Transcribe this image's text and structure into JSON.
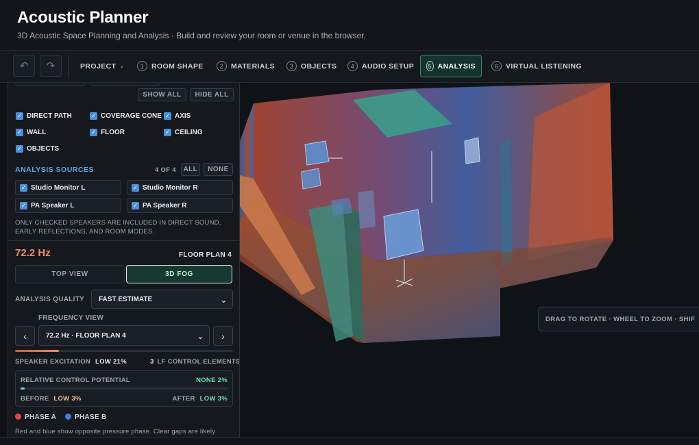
{
  "header": {
    "title": "Acoustic Planner",
    "subtitle": "3D Acoustic Space Planning and Analysis · Build and review your room or venue in the browser."
  },
  "toolbar": {
    "undo_icon": "undo-icon",
    "redo_icon": "redo-icon",
    "project_label": "PROJECT",
    "tabs": [
      {
        "num": "1",
        "label": "ROOM SHAPE"
      },
      {
        "num": "2",
        "label": "MATERIALS"
      },
      {
        "num": "3",
        "label": "OBJECTS"
      },
      {
        "num": "4",
        "label": "AUDIO SETUP"
      },
      {
        "num": "5",
        "label": "ANALYSIS",
        "active": true
      },
      {
        "num": "6",
        "label": "VIRTUAL LISTENING"
      }
    ]
  },
  "panel": {
    "show_all": "SHOW ALL",
    "hide_all": "HIDE ALL",
    "toggles": [
      {
        "label": "DIRECT PATH",
        "checked": true
      },
      {
        "label": "COVERAGE CONE",
        "checked": true
      },
      {
        "label": "AXIS",
        "checked": true
      },
      {
        "label": "WALL",
        "checked": true
      },
      {
        "label": "FLOOR",
        "checked": true
      },
      {
        "label": "CEILING",
        "checked": true
      },
      {
        "label": "OBJECTS",
        "checked": true
      }
    ],
    "sources": {
      "title": "ANALYSIS SOURCES",
      "count": "4 OF 4",
      "all": "ALL",
      "none": "NONE",
      "items": [
        {
          "label": "Studio Monitor L",
          "checked": true
        },
        {
          "label": "Studio Monitor R",
          "checked": true
        },
        {
          "label": "PA Speaker L",
          "checked": true
        },
        {
          "label": "PA Speaker R",
          "checked": true
        }
      ],
      "note_line1": "ONLY CHECKED SPEAKERS ARE INCLUDED IN DIRECT SOUND,",
      "note_line2": "EARLY REFLECTIONS, AND ROOM MODES."
    },
    "frequency": "72.2 Hz",
    "floor_plan": "FLOOR PLAN 4",
    "views": {
      "top": "TOP VIEW",
      "fog": "3D FOG",
      "active": "fog"
    },
    "quality_label": "ANALYSIS QUALITY",
    "quality_value": "FAST ESTIMATE",
    "frequency_view_label": "FREQUENCY VIEW",
    "frequency_view_value": "72.2 Hz · FLOOR PLAN 4",
    "frequency_view_progress": 0.2,
    "excitation_label": "SPEAKER EXCITATION",
    "excitation_value": "LOW 21%",
    "lf_count": "3",
    "lf_label": "LF CONTROL ELEMENTS",
    "rcp": {
      "title": "RELATIVE CONTROL POTENTIAL",
      "value": "NONE 2%",
      "progress": 0.02,
      "before_label": "BEFORE",
      "before_value": "LOW 3%",
      "after_label": "AFTER",
      "after_value": "LOW 3%"
    },
    "legend": {
      "phase_a": "PHASE A",
      "phase_b": "PHASE B",
      "color_a": "#e0473d",
      "color_b": "#3b7fe0"
    },
    "legend_note": "Red and blue show opposite pressure phase. Clear gaps are likely"
  },
  "viewport": {
    "hint": "DRAG TO ROTATE · WHEEL TO ZOOM · SHIF"
  },
  "colors": {
    "accent": "#3b8c73",
    "link": "#5fa4e6",
    "frequency": "#f2876e",
    "checkbox": "#4a8fe0"
  }
}
